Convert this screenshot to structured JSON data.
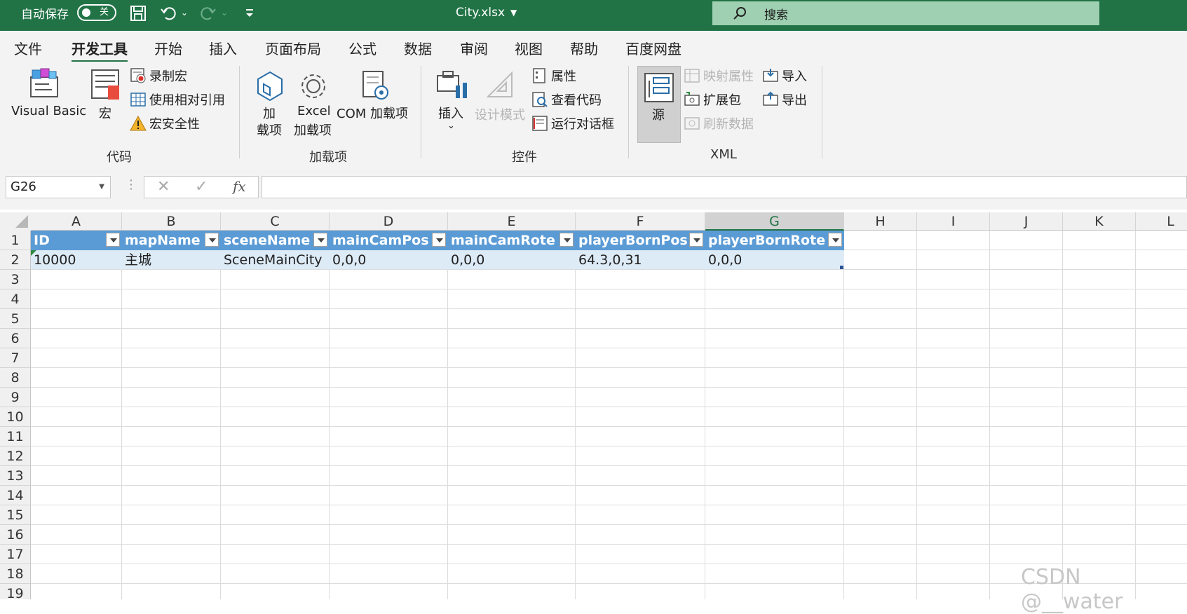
{
  "titlebar": {
    "autosave_label": "自动保存",
    "autosave_state": "关",
    "filename": "City.xlsx",
    "search_placeholder": "搜索"
  },
  "tabs": [
    "文件",
    "开发工具",
    "开始",
    "插入",
    "页面布局",
    "公式",
    "数据",
    "审阅",
    "视图",
    "帮助",
    "百度网盘"
  ],
  "active_tab": "开发工具",
  "ribbon": {
    "code": {
      "group_label": "代码",
      "visual_basic": "Visual Basic",
      "macros": "宏",
      "record_macro": "录制宏",
      "relative_ref": "使用相对引用",
      "macro_security": "宏安全性"
    },
    "addins": {
      "group_label": "加载项",
      "addins_1": "加",
      "addins_2": "载项",
      "excel_addins_1": "Excel",
      "excel_addins_2": "加载项",
      "com_addins": "COM 加载项"
    },
    "controls": {
      "group_label": "控件",
      "insert": "插入",
      "design_mode": "设计模式",
      "properties": "属性",
      "view_code": "查看代码",
      "run_dialog": "运行对话框"
    },
    "xml": {
      "group_label": "XML",
      "source": "源",
      "map_properties": "映射属性",
      "expansion_packs": "扩展包",
      "refresh_data": "刷新数据",
      "import": "导入",
      "export": "导出"
    }
  },
  "formula_bar": {
    "name_box": "G26",
    "fx": "fx",
    "value": ""
  },
  "grid": {
    "columns": [
      "A",
      "B",
      "C",
      "D",
      "E",
      "F",
      "G",
      "H",
      "I",
      "J",
      "K",
      "L"
    ],
    "selected_column": "G",
    "rows": [
      "1",
      "2",
      "3",
      "4",
      "5",
      "6",
      "7",
      "8",
      "9",
      "10",
      "11",
      "12",
      "13",
      "14",
      "15",
      "16",
      "17",
      "18",
      "19"
    ],
    "table_headers": [
      "ID",
      "mapName",
      "sceneName",
      "mainCamPos",
      "mainCamRote",
      "playerBornPos",
      "playerBornRote"
    ],
    "table_rows": [
      [
        "10000",
        "主城",
        "SceneMainCity",
        "0,0,0",
        "0,0,0",
        "64.3,0,31",
        "0,0,0"
      ]
    ]
  },
  "watermark": "CSDN @__water"
}
